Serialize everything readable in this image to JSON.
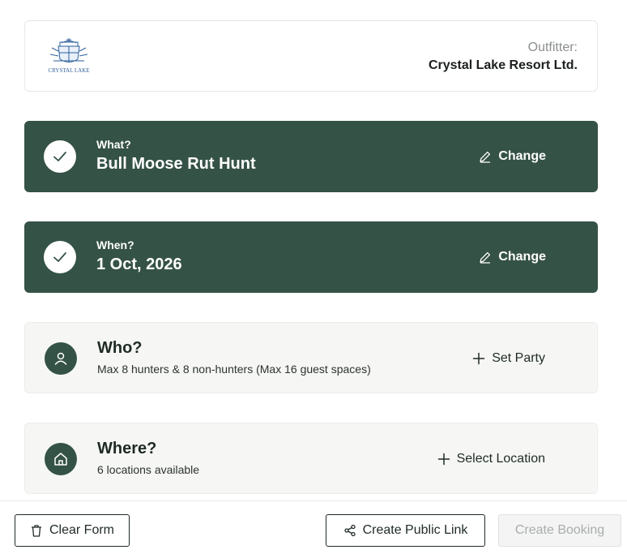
{
  "outfitter": {
    "label": "Outfitter:",
    "name": "Crystal Lake Resort Ltd.",
    "logo_text": "CRYSTAL LAKE"
  },
  "steps": [
    {
      "state": "done",
      "question": "What?",
      "value": "Bull Moose Rut Hunt",
      "action": "Change",
      "action_icon": "pencil-icon"
    },
    {
      "state": "done",
      "question": "When?",
      "value": "1 Oct, 2026",
      "action": "Change",
      "action_icon": "pencil-icon"
    },
    {
      "state": "todo",
      "question": "Who?",
      "detail": "Max 8 hunters & 8 non-hunters (Max 16 guest spaces)",
      "action": "Set Party",
      "icon": "person-icon",
      "action_icon": "plus-icon"
    },
    {
      "state": "todo",
      "question": "Where?",
      "detail": "6 locations available",
      "action": "Select Location",
      "icon": "home-icon",
      "action_icon": "plus-icon"
    }
  ],
  "footer": {
    "clear": "Clear Form",
    "public_link": "Create Public Link",
    "create_booking": "Create Booking"
  },
  "colors": {
    "primary": "#355246",
    "muted_card": "#f6f7f5"
  }
}
